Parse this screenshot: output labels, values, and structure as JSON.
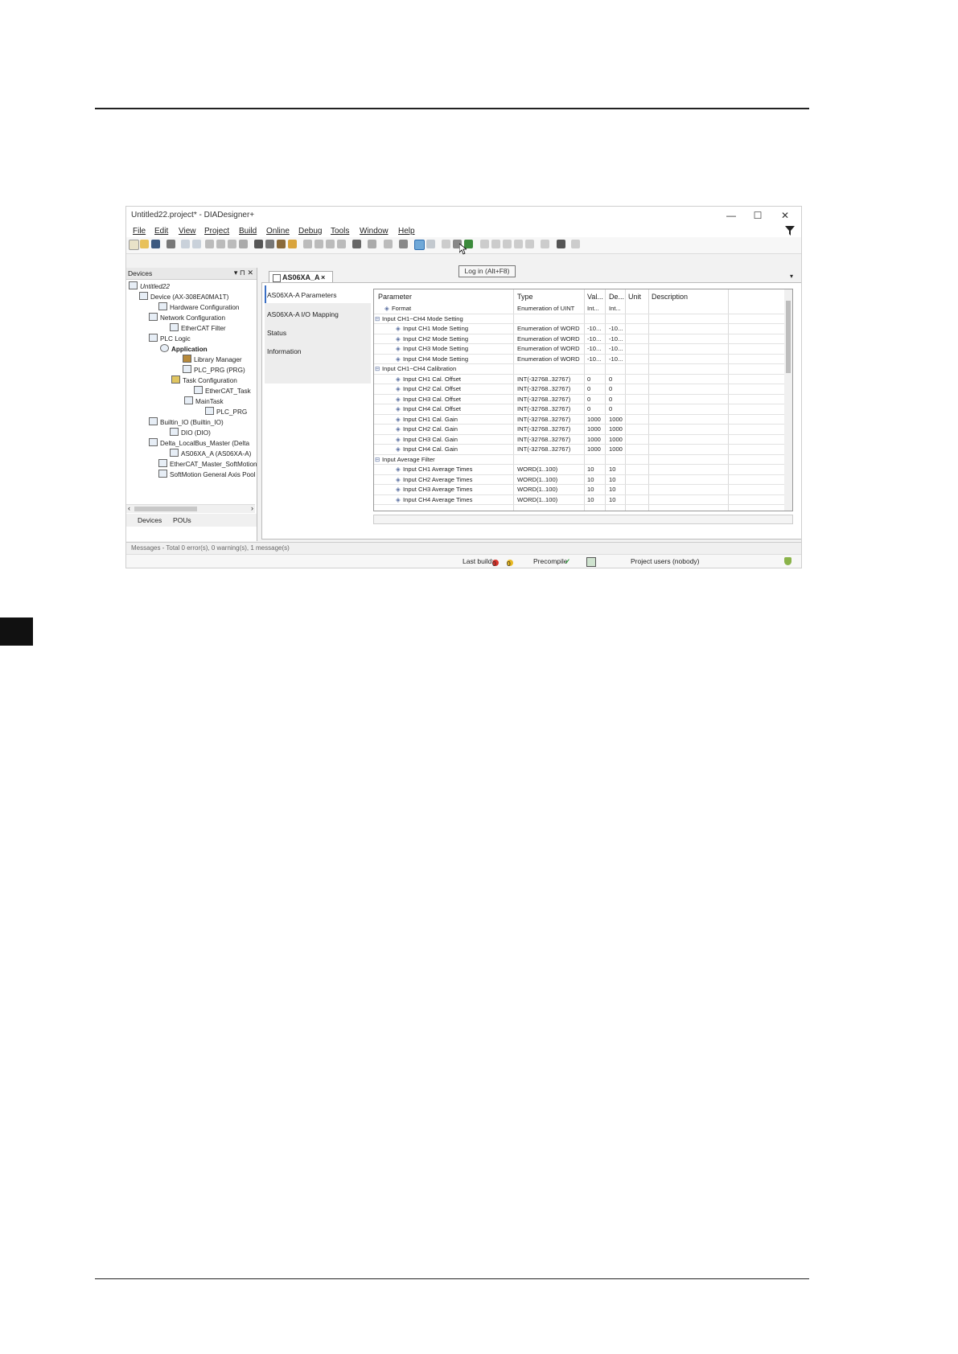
{
  "window": {
    "title": "Untitled22.project* - DIADesigner+",
    "controls": {
      "minimize": "—",
      "maximize": "☐",
      "close": "✕"
    }
  },
  "menu": [
    "File",
    "Edit",
    "View",
    "Project",
    "Build",
    "Online",
    "Debug",
    "Tools",
    "Window",
    "Help"
  ],
  "tooltip": "Log in (Alt+F8)",
  "devices_panel": {
    "title": "Devices",
    "header_icons": "▾ ⊓ ✕",
    "tree": [
      "Untitled22",
      "Device (AX-308EA0MA1T)",
      "Hardware Configuration",
      "Network Configuration",
      "EtherCAT Filter",
      "PLC Logic",
      "Application",
      "Library Manager",
      "PLC_PRG (PRG)",
      "Task Configuration",
      "EtherCAT_Task",
      "MainTask",
      "PLC_PRG",
      "Builtin_IO (Builtin_IO)",
      "DIO (DIO)",
      "Delta_LocalBus_Master (Delta",
      "AS06XA_A (AS06XA-A)",
      "EtherCAT_Master_SoftMotion",
      "SoftMotion General Axis Pool"
    ],
    "tabs": [
      "Devices",
      "POUs"
    ]
  },
  "editor": {
    "tab": "AS06XA_A",
    "side_tabs": [
      "AS06XA-A Parameters",
      "AS06XA-A I/O Mapping",
      "Status",
      "Information"
    ],
    "columns": [
      "Parameter",
      "Type",
      "Val...",
      "De...",
      "Unit",
      "Description"
    ],
    "rows": [
      [
        "Format",
        "Enumeration of UINT",
        "Int...",
        "Int..."
      ],
      [
        "Input CH1~CH4 Mode Setting",
        "",
        "",
        ""
      ],
      [
        "Input CH1 Mode Setting",
        "Enumeration of WORD",
        "-10...",
        "-10..."
      ],
      [
        "Input CH2 Mode Setting",
        "Enumeration of WORD",
        "-10...",
        "-10..."
      ],
      [
        "Input CH3 Mode Setting",
        "Enumeration of WORD",
        "-10...",
        "-10..."
      ],
      [
        "Input CH4 Mode Setting",
        "Enumeration of WORD",
        "-10...",
        "-10..."
      ],
      [
        "Input CH1~CH4 Calibration",
        "",
        "",
        ""
      ],
      [
        "Input CH1 Cal. Offset",
        "INT(-32768..32767)",
        "0",
        "0"
      ],
      [
        "Input CH2 Cal. Offset",
        "INT(-32768..32767)",
        "0",
        "0"
      ],
      [
        "Input CH3 Cal. Offset",
        "INT(-32768..32767)",
        "0",
        "0"
      ],
      [
        "Input CH4 Cal. Offset",
        "INT(-32768..32767)",
        "0",
        "0"
      ],
      [
        "Input CH1 Cal. Gain",
        "INT(-32768..32767)",
        "1000",
        "1000"
      ],
      [
        "Input CH2 Cal. Gain",
        "INT(-32768..32767)",
        "1000",
        "1000"
      ],
      [
        "Input CH3 Cal. Gain",
        "INT(-32768..32767)",
        "1000",
        "1000"
      ],
      [
        "Input CH4 Cal. Gain",
        "INT(-32768..32767)",
        "1000",
        "1000"
      ],
      [
        "Input Average Filter",
        "",
        "",
        ""
      ],
      [
        "Input CH1 Average Times",
        "WORD(1..100)",
        "10",
        "10"
      ],
      [
        "Input CH2 Average Times",
        "WORD(1..100)",
        "10",
        "10"
      ],
      [
        "Input CH3 Average Times",
        "WORD(1..100)",
        "10",
        "10"
      ],
      [
        "Input CH4 Average Times",
        "WORD(1..100)",
        "10",
        "10"
      ]
    ]
  },
  "messages": "Messages - Total 0 error(s), 0 warning(s), 1 message(s)",
  "status": {
    "last_build": "Last build:",
    "errors": "0",
    "warnings": "0",
    "precompile": "Precompile",
    "project_users": "Project users (nobody)"
  },
  "colors": {
    "accent": "#3a6fc4",
    "error": "#d9342b",
    "warning": "#e8b923",
    "ok": "#2e9e3c"
  }
}
